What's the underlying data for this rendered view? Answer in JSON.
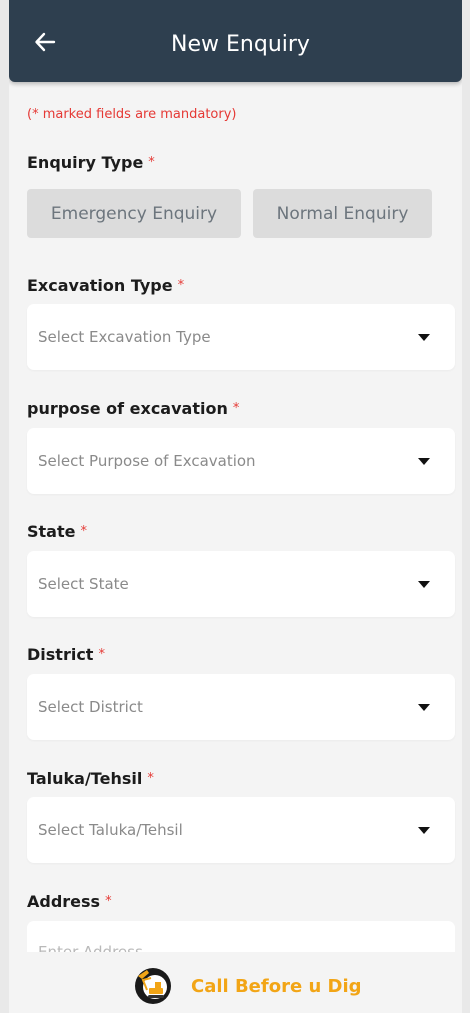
{
  "app_bar": {
    "title": "New Enquiry",
    "back_icon": "arrow-left-icon",
    "background": "#2e3f4f"
  },
  "form": {
    "mandatory_note": "(* marked fields are mandatory)",
    "required_marker": "*",
    "enquiry_type": {
      "label": "Enquiry Type",
      "options": [
        "Emergency Enquiry",
        "Normal Enquiry"
      ]
    },
    "excavation_type": {
      "label": "Excavation Type",
      "placeholder": "Select Excavation Type"
    },
    "purpose": {
      "label": "purpose of excavation",
      "placeholder": "Select Purpose of Excavation"
    },
    "state": {
      "label": "State",
      "placeholder": "Select State"
    },
    "district": {
      "label": "District",
      "placeholder": "Select District"
    },
    "taluka": {
      "label": "Taluka/Tehsil",
      "placeholder": "Select Taluka/Tehsil"
    },
    "address": {
      "label": "Address",
      "placeholder": "Enter Address"
    }
  },
  "footer": {
    "brand": "Call Before u Dig",
    "logo_icon": "excavator-logo-icon",
    "brand_color": "#f2a516"
  },
  "colors": {
    "required": "#e53935",
    "chip_background": "#dcdcdc",
    "page_background": "#f4f4f4"
  }
}
